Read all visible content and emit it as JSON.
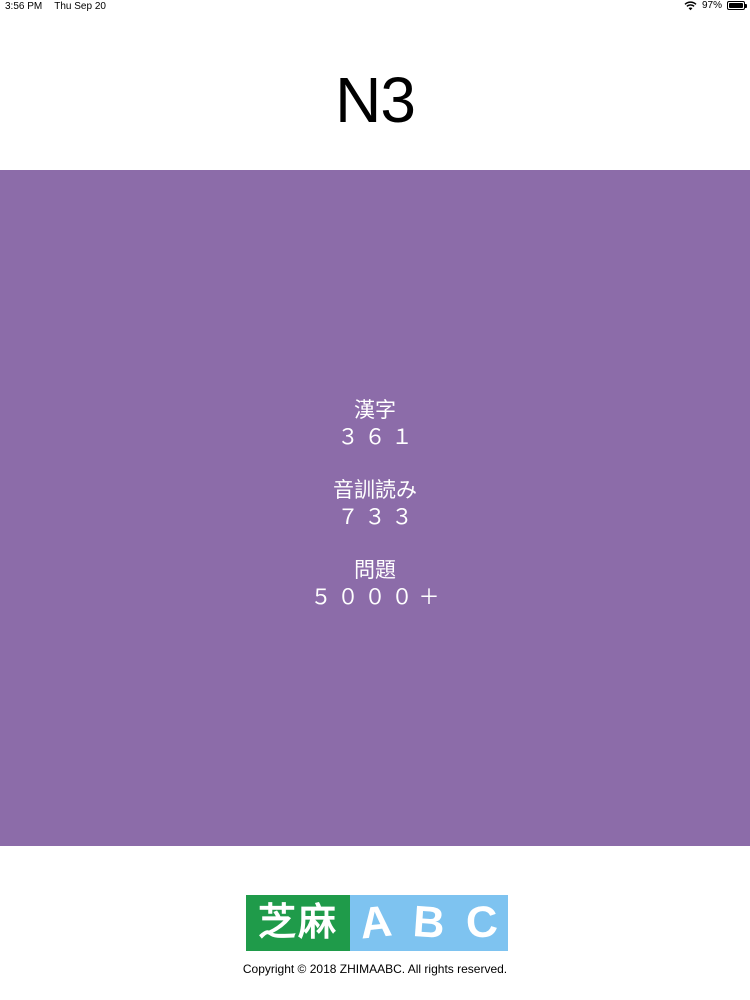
{
  "status_bar": {
    "time": "3:56 PM",
    "date": "Thu Sep 20",
    "battery": "97%",
    "battery_level": 0.97
  },
  "title": "N3",
  "stats": [
    {
      "label": "漢字",
      "value": "３６１"
    },
    {
      "label": "音訓読み",
      "value": "７３３"
    },
    {
      "label": "問題",
      "value": "５０００＋"
    }
  ],
  "logo": {
    "cn": "芝麻",
    "abc": [
      "A",
      "B",
      "C"
    ]
  },
  "copyright": "Copyright © 2018 ZHIMAABC. All rights reserved.",
  "colors": {
    "panel": "#8c6ca9",
    "logo_green": "#1f9b4a",
    "logo_blue": "#7ec3f0"
  }
}
